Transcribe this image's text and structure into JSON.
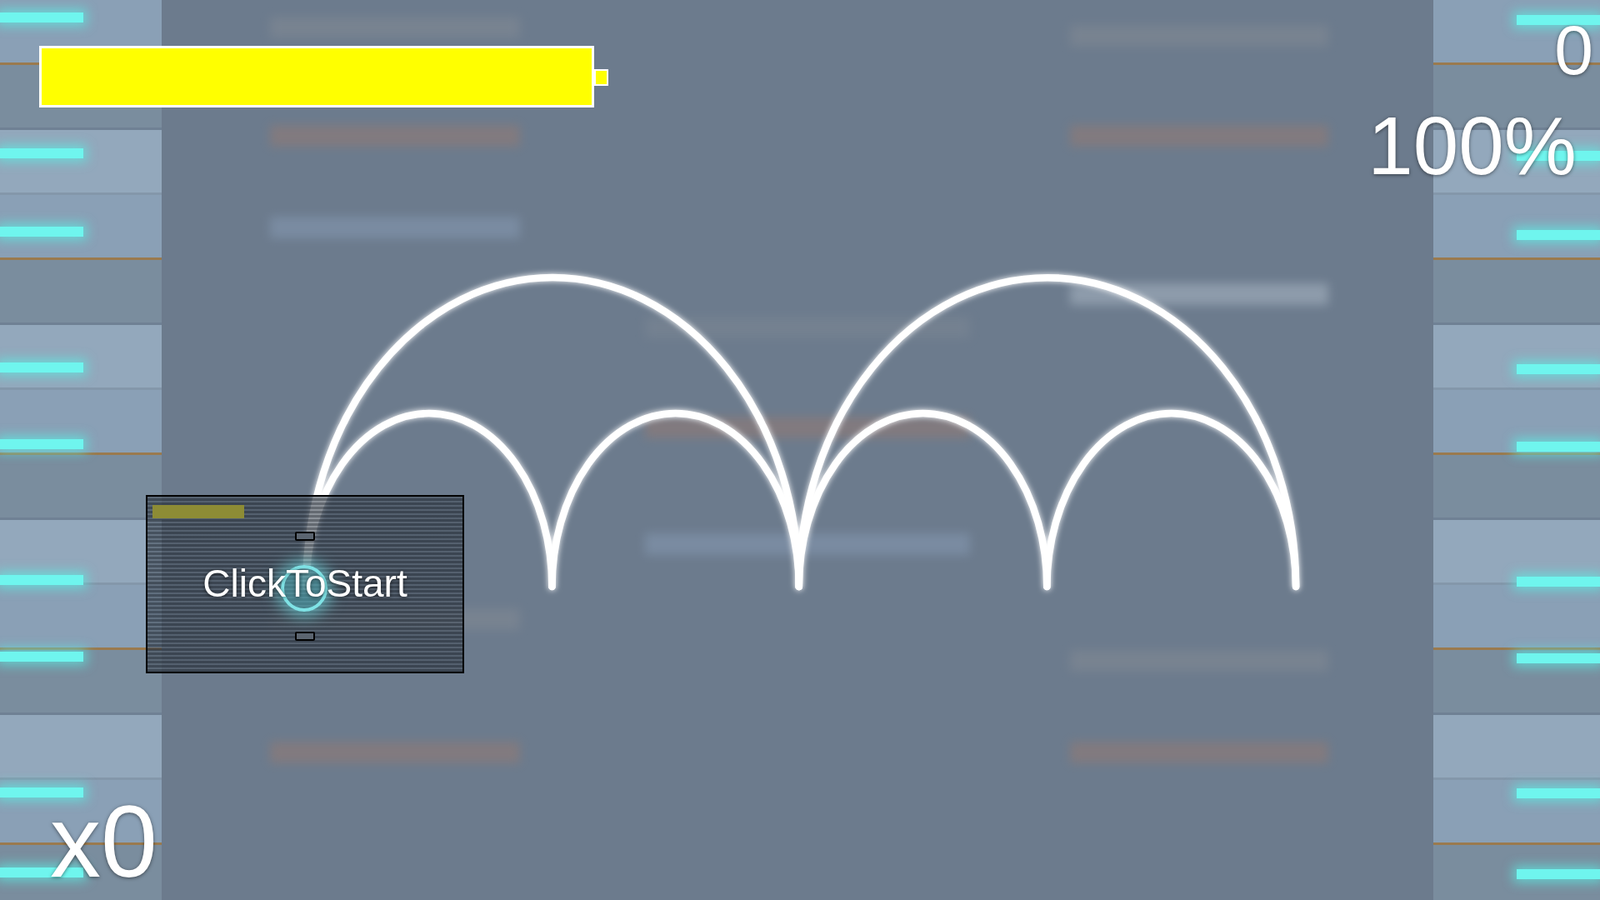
{
  "hud": {
    "health": {
      "level": 1.0
    },
    "score": "0",
    "accuracy": "100%",
    "combo": "x0"
  },
  "start_box": {
    "label": "ClickToStart",
    "level": 1.0
  }
}
